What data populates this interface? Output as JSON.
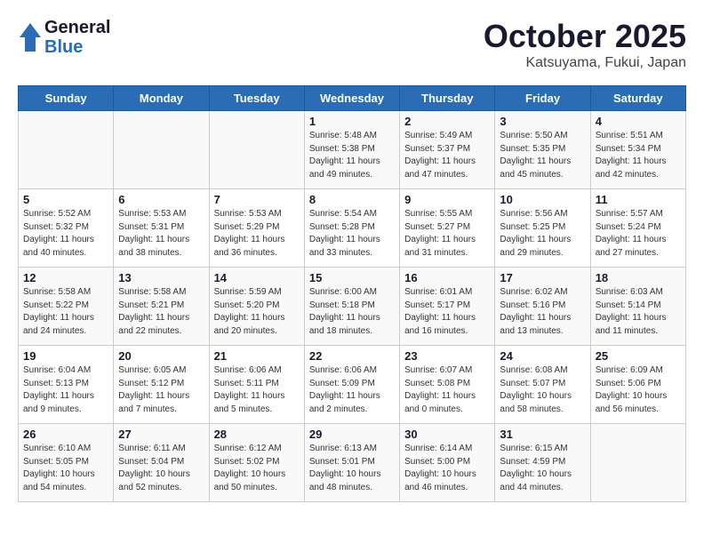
{
  "header": {
    "logo_line1": "General",
    "logo_line2": "Blue",
    "title": "October 2025",
    "subtitle": "Katsuyama, Fukui, Japan"
  },
  "days_of_week": [
    "Sunday",
    "Monday",
    "Tuesday",
    "Wednesday",
    "Thursday",
    "Friday",
    "Saturday"
  ],
  "weeks": [
    [
      {
        "num": "",
        "info": ""
      },
      {
        "num": "",
        "info": ""
      },
      {
        "num": "",
        "info": ""
      },
      {
        "num": "1",
        "info": "Sunrise: 5:48 AM\nSunset: 5:38 PM\nDaylight: 11 hours and 49 minutes."
      },
      {
        "num": "2",
        "info": "Sunrise: 5:49 AM\nSunset: 5:37 PM\nDaylight: 11 hours and 47 minutes."
      },
      {
        "num": "3",
        "info": "Sunrise: 5:50 AM\nSunset: 5:35 PM\nDaylight: 11 hours and 45 minutes."
      },
      {
        "num": "4",
        "info": "Sunrise: 5:51 AM\nSunset: 5:34 PM\nDaylight: 11 hours and 42 minutes."
      }
    ],
    [
      {
        "num": "5",
        "info": "Sunrise: 5:52 AM\nSunset: 5:32 PM\nDaylight: 11 hours and 40 minutes."
      },
      {
        "num": "6",
        "info": "Sunrise: 5:53 AM\nSunset: 5:31 PM\nDaylight: 11 hours and 38 minutes."
      },
      {
        "num": "7",
        "info": "Sunrise: 5:53 AM\nSunset: 5:29 PM\nDaylight: 11 hours and 36 minutes."
      },
      {
        "num": "8",
        "info": "Sunrise: 5:54 AM\nSunset: 5:28 PM\nDaylight: 11 hours and 33 minutes."
      },
      {
        "num": "9",
        "info": "Sunrise: 5:55 AM\nSunset: 5:27 PM\nDaylight: 11 hours and 31 minutes."
      },
      {
        "num": "10",
        "info": "Sunrise: 5:56 AM\nSunset: 5:25 PM\nDaylight: 11 hours and 29 minutes."
      },
      {
        "num": "11",
        "info": "Sunrise: 5:57 AM\nSunset: 5:24 PM\nDaylight: 11 hours and 27 minutes."
      }
    ],
    [
      {
        "num": "12",
        "info": "Sunrise: 5:58 AM\nSunset: 5:22 PM\nDaylight: 11 hours and 24 minutes."
      },
      {
        "num": "13",
        "info": "Sunrise: 5:58 AM\nSunset: 5:21 PM\nDaylight: 11 hours and 22 minutes."
      },
      {
        "num": "14",
        "info": "Sunrise: 5:59 AM\nSunset: 5:20 PM\nDaylight: 11 hours and 20 minutes."
      },
      {
        "num": "15",
        "info": "Sunrise: 6:00 AM\nSunset: 5:18 PM\nDaylight: 11 hours and 18 minutes."
      },
      {
        "num": "16",
        "info": "Sunrise: 6:01 AM\nSunset: 5:17 PM\nDaylight: 11 hours and 16 minutes."
      },
      {
        "num": "17",
        "info": "Sunrise: 6:02 AM\nSunset: 5:16 PM\nDaylight: 11 hours and 13 minutes."
      },
      {
        "num": "18",
        "info": "Sunrise: 6:03 AM\nSunset: 5:14 PM\nDaylight: 11 hours and 11 minutes."
      }
    ],
    [
      {
        "num": "19",
        "info": "Sunrise: 6:04 AM\nSunset: 5:13 PM\nDaylight: 11 hours and 9 minutes."
      },
      {
        "num": "20",
        "info": "Sunrise: 6:05 AM\nSunset: 5:12 PM\nDaylight: 11 hours and 7 minutes."
      },
      {
        "num": "21",
        "info": "Sunrise: 6:06 AM\nSunset: 5:11 PM\nDaylight: 11 hours and 5 minutes."
      },
      {
        "num": "22",
        "info": "Sunrise: 6:06 AM\nSunset: 5:09 PM\nDaylight: 11 hours and 2 minutes."
      },
      {
        "num": "23",
        "info": "Sunrise: 6:07 AM\nSunset: 5:08 PM\nDaylight: 11 hours and 0 minutes."
      },
      {
        "num": "24",
        "info": "Sunrise: 6:08 AM\nSunset: 5:07 PM\nDaylight: 10 hours and 58 minutes."
      },
      {
        "num": "25",
        "info": "Sunrise: 6:09 AM\nSunset: 5:06 PM\nDaylight: 10 hours and 56 minutes."
      }
    ],
    [
      {
        "num": "26",
        "info": "Sunrise: 6:10 AM\nSunset: 5:05 PM\nDaylight: 10 hours and 54 minutes."
      },
      {
        "num": "27",
        "info": "Sunrise: 6:11 AM\nSunset: 5:04 PM\nDaylight: 10 hours and 52 minutes."
      },
      {
        "num": "28",
        "info": "Sunrise: 6:12 AM\nSunset: 5:02 PM\nDaylight: 10 hours and 50 minutes."
      },
      {
        "num": "29",
        "info": "Sunrise: 6:13 AM\nSunset: 5:01 PM\nDaylight: 10 hours and 48 minutes."
      },
      {
        "num": "30",
        "info": "Sunrise: 6:14 AM\nSunset: 5:00 PM\nDaylight: 10 hours and 46 minutes."
      },
      {
        "num": "31",
        "info": "Sunrise: 6:15 AM\nSunset: 4:59 PM\nDaylight: 10 hours and 44 minutes."
      },
      {
        "num": "",
        "info": ""
      }
    ]
  ]
}
